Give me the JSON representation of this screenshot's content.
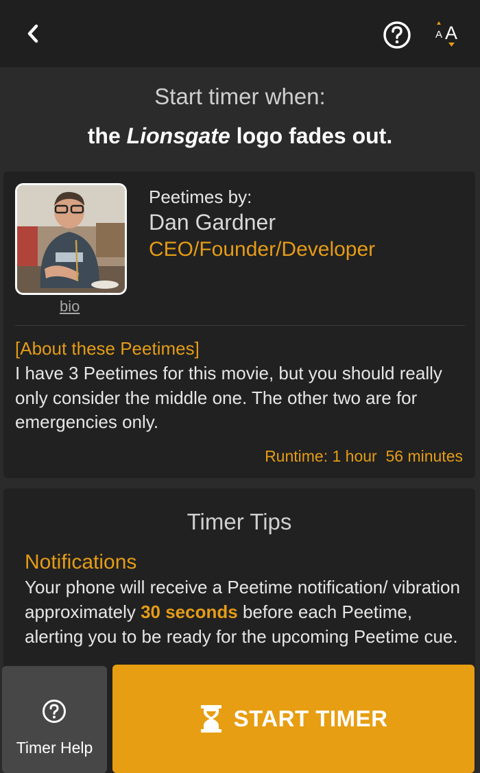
{
  "header": {
    "back_icon": "chevron-left-icon",
    "help_icon": "question-circle-icon",
    "font_size_icon": "font-size-icon"
  },
  "cue": {
    "heading": "Start timer when:",
    "prefix": "the ",
    "emphasis": "Lionsgate",
    "suffix": " logo fades out."
  },
  "author": {
    "by_label": "Peetimes by:",
    "name": "Dan Gardner",
    "role": "CEO/Founder/Developer",
    "bio_link": "bio"
  },
  "about": {
    "title": "[About these Peetimes]",
    "text": "I have 3 Peetimes for this movie, but you should really only consider the middle one. The other two are for emergencies only.",
    "runtime": "Runtime: 1 hour  56 minutes"
  },
  "tips": {
    "title": "Timer Tips",
    "notifications_title": "Notifications",
    "notifications_text_before": "Your phone will receive a Peetime notification/ vibration approximately ",
    "notifications_highlight": "30 seconds",
    "notifications_text_after": " before each Peetime, alerting you to be ready for the upcoming Peetime cue."
  },
  "actions": {
    "timer_help_label": "Timer Help",
    "start_timer_label": "START TIMER"
  },
  "colors": {
    "accent": "#e59c16",
    "button": "#e79e12",
    "background": "#2b2b2b",
    "card": "#212121",
    "topbar": "#1f1f1f"
  }
}
